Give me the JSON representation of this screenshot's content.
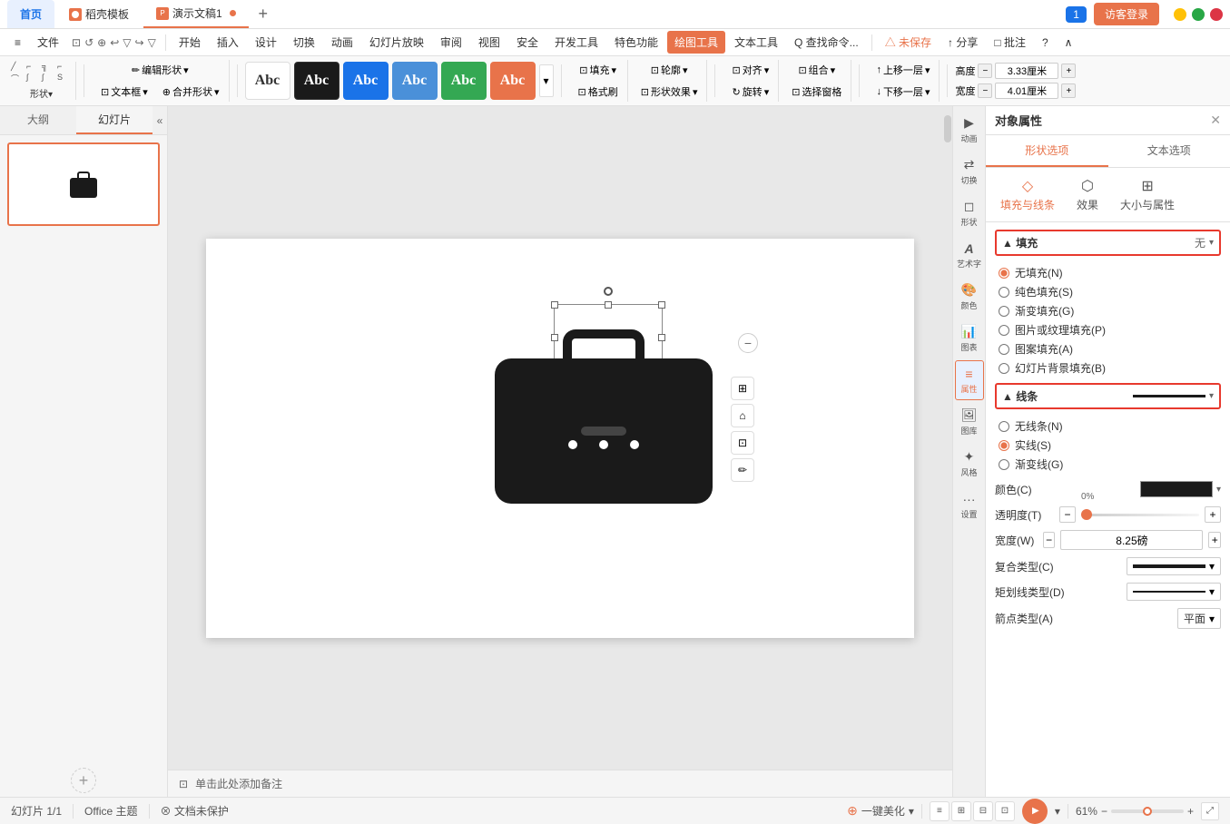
{
  "titleBar": {
    "tabs": [
      {
        "id": "home",
        "label": "首页",
        "active": false,
        "type": "home"
      },
      {
        "id": "template",
        "label": "稻壳模板",
        "active": false,
        "type": "template"
      },
      {
        "id": "doc",
        "label": "演示文稿1",
        "active": true,
        "type": "doc"
      }
    ],
    "addTab": "+",
    "userCount": "1",
    "loginBtn": "访客登录",
    "winMin": "—",
    "winMax": "□",
    "winClose": "✕"
  },
  "menuBar": {
    "items": [
      {
        "id": "menu-icon",
        "label": "≡"
      },
      {
        "id": "file",
        "label": "文件"
      },
      {
        "id": "icons-group",
        "label": "⊡ ↺ ⊕ ↩ ▽ ↪ ▽"
      },
      {
        "id": "start",
        "label": "开始"
      },
      {
        "id": "insert",
        "label": "插入"
      },
      {
        "id": "design",
        "label": "设计"
      },
      {
        "id": "switch",
        "label": "切换"
      },
      {
        "id": "animation",
        "label": "动画"
      },
      {
        "id": "slideshow",
        "label": "幻灯片放映"
      },
      {
        "id": "review",
        "label": "审阅"
      },
      {
        "id": "view",
        "label": "视图"
      },
      {
        "id": "security",
        "label": "安全"
      },
      {
        "id": "dev",
        "label": "开发工具"
      },
      {
        "id": "special",
        "label": "特色功能"
      },
      {
        "id": "draw",
        "label": "绘图工具",
        "highlight": true
      },
      {
        "id": "text",
        "label": "文本工具"
      },
      {
        "id": "search",
        "label": "Q 查找命令..."
      },
      {
        "id": "unsave",
        "label": "△ 未保存"
      },
      {
        "id": "share",
        "label": "↑ 分享"
      },
      {
        "id": "batch",
        "label": "□ 批注"
      },
      {
        "id": "help",
        "label": "?"
      },
      {
        "id": "expand",
        "label": "∧"
      }
    ]
  },
  "toolbar": {
    "shapeLabel": "形状▾",
    "editShapeLabel": "✏ 编辑形状▾",
    "textFrameLabel": "⊡ 文本框▾",
    "mergeShapeLabel": "⊕ 合并形状▾",
    "styleButtons": [
      {
        "id": "s1",
        "label": "Abc",
        "class": "white"
      },
      {
        "id": "s2",
        "label": "Abc",
        "class": "black"
      },
      {
        "id": "s3",
        "label": "Abc",
        "class": "blue1"
      },
      {
        "id": "s4",
        "label": "Abc",
        "class": "blue2"
      },
      {
        "id": "s5",
        "label": "Abc",
        "class": "green"
      },
      {
        "id": "s6",
        "label": "Abc",
        "class": "orange"
      }
    ],
    "fillLabel": "⊡ 填充▾",
    "formatBrushLabel": "⊡ 格式刷",
    "outlineLabel": "⊡ 轮廓▾",
    "shapeEffectLabel": "⊡ 形状效果▾",
    "alignLabel": "⊡ 对齐▾",
    "rotateLabel": "↻ 旋转▾",
    "groupLabel": "⊡ 组合▾",
    "selectFitLabel": "⊡ 选择窗格",
    "upLayerLabel": "↑ 上移一层▾",
    "downLayerLabel": "↓ 下移一层▾",
    "heightLabel": "高度",
    "heightValue": "3.33厘米",
    "widthLabel": "宽度",
    "widthValue": "4.01厘米"
  },
  "leftPanel": {
    "tabs": [
      {
        "id": "outline",
        "label": "大纲"
      },
      {
        "id": "slides",
        "label": "幻灯片",
        "active": true
      }
    ],
    "slideCount": "1",
    "addSlide": "+"
  },
  "canvas": {
    "slideNum": "1"
  },
  "propsPanel": {
    "title": "对象属性",
    "tabs": [
      {
        "id": "shape-options",
        "label": "形状选项",
        "active": true
      },
      {
        "id": "text-options",
        "label": "文本选项"
      }
    ],
    "subtabs": [
      {
        "id": "fill-line",
        "label": "填充与线条",
        "active": true,
        "icon": "◇"
      },
      {
        "id": "effects",
        "label": "效果",
        "icon": "⬡"
      },
      {
        "id": "size-props",
        "label": "大小与属性",
        "icon": "⊞"
      }
    ],
    "fillSection": {
      "title": "▲ 填充",
      "value": "无",
      "options": [
        {
          "id": "no-fill",
          "label": "无填充(N)",
          "checked": true
        },
        {
          "id": "solid-fill",
          "label": "纯色填充(S)",
          "checked": false
        },
        {
          "id": "gradient-fill",
          "label": "渐变填充(G)",
          "checked": false
        },
        {
          "id": "picture-fill",
          "label": "图片或纹理填充(P)",
          "checked": false
        },
        {
          "id": "pattern-fill",
          "label": "图案填充(A)",
          "checked": false
        },
        {
          "id": "slide-bg-fill",
          "label": "幻灯片背景填充(B)",
          "checked": false
        }
      ]
    },
    "lineSection": {
      "title": "▲ 线条",
      "options": [
        {
          "id": "no-line",
          "label": "无线条(N)",
          "checked": false
        },
        {
          "id": "solid-line",
          "label": "实线(S)",
          "checked": true
        },
        {
          "id": "gradient-line",
          "label": "渐变线(G)",
          "checked": false
        }
      ],
      "colorLabel": "颜色(C)",
      "transparencyLabel": "透明度(T)",
      "transparencyValue": "0%",
      "widthLabel": "宽度(W)",
      "widthValue": "8.25磅",
      "compoundTypeLabel": "复合类型(C)",
      "dashTypeLabel": "矩划线类型(D)",
      "arrowTypeLabel": "箭点类型(A)",
      "arrowTypeValue": "平面"
    }
  },
  "rightRail": {
    "items": [
      {
        "id": "animation",
        "label": "动画",
        "icon": "▶"
      },
      {
        "id": "transition",
        "label": "切换",
        "icon": "⇄"
      },
      {
        "id": "shape-prop",
        "label": "形状",
        "icon": "◻",
        "active": false
      },
      {
        "id": "artword",
        "label": "艺术字",
        "icon": "A"
      },
      {
        "id": "color",
        "label": "颜色",
        "icon": "🎨"
      },
      {
        "id": "chart",
        "label": "图表",
        "icon": "📊"
      },
      {
        "id": "props",
        "label": "属性",
        "icon": "≡",
        "active": true
      },
      {
        "id": "imglib",
        "label": "图库",
        "icon": "🖼"
      },
      {
        "id": "style",
        "label": "风格",
        "icon": "✦"
      },
      {
        "id": "settings",
        "label": "设置",
        "icon": "···"
      }
    ]
  },
  "statusBar": {
    "slideInfo": "幻灯片 1/1",
    "theme": "Office 主题",
    "docProtect": "⊗ 文档未保护",
    "beautify": "⊕ 一键美化 ▾",
    "viewIcon": "≡·",
    "zoomValue": "61%",
    "fullscreen": "⤢"
  },
  "annotationBar": {
    "icon": "⊡",
    "text": "单击此处添加备注"
  }
}
